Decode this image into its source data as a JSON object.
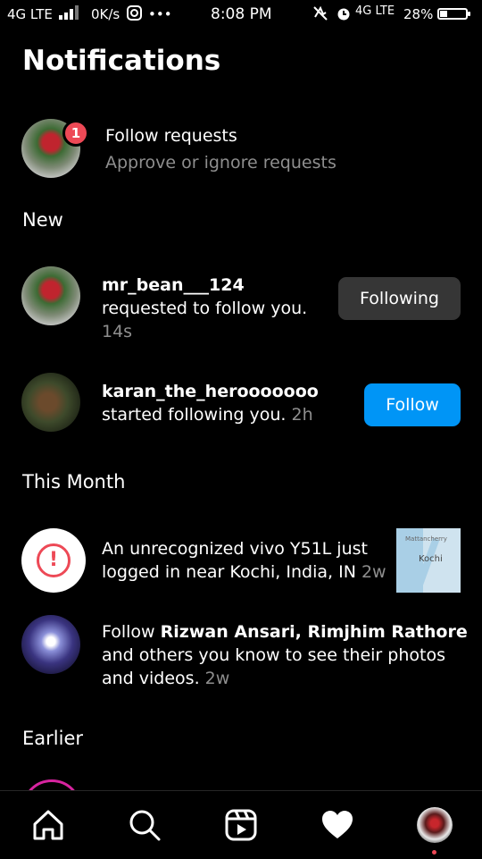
{
  "status_bar": {
    "network_left": "4G LTE",
    "speed": "0K/s",
    "more": "•••",
    "time": "8:08 PM",
    "network_right": "4G LTE",
    "battery": "28%",
    "battery_level": 0.28
  },
  "header": {
    "title": "Notifications"
  },
  "follow_requests": {
    "badge": "1",
    "title": "Follow requests",
    "subtitle": "Approve or ignore requests"
  },
  "sections": {
    "new": "New",
    "this_month": "This Month",
    "earlier": "Earlier"
  },
  "notifications": {
    "request": {
      "username": "mr_bean___124",
      "text": "requested to follow you.",
      "time": "14s",
      "button": "Following"
    },
    "follow": {
      "username": "karan_the_herooooooo",
      "text": "started following you.",
      "time": "2h",
      "button": "Follow"
    },
    "login": {
      "line1": "An unrecognized vivo Y51L just",
      "line2": "logged in near Kochi, India, IN",
      "time": "2w",
      "icon": "!",
      "map_place": "Mattancherry",
      "map_city": "Kochi"
    },
    "suggest": {
      "prefix": "Follow",
      "names": "Rizwan Ansari, Rimjhim Rathore",
      "line2": "and others you know to see their photos",
      "line3": "and videos.",
      "time": "2w"
    }
  },
  "nav": {
    "items": [
      "home-icon",
      "search-icon",
      "reels-icon",
      "heart-icon",
      "profile-avatar"
    ]
  },
  "colors": {
    "background": "#000000",
    "accent_blue": "#0095f6",
    "badge_red": "#ed4956",
    "secondary_text": "#8e8e8e",
    "button_gray": "#363636"
  }
}
